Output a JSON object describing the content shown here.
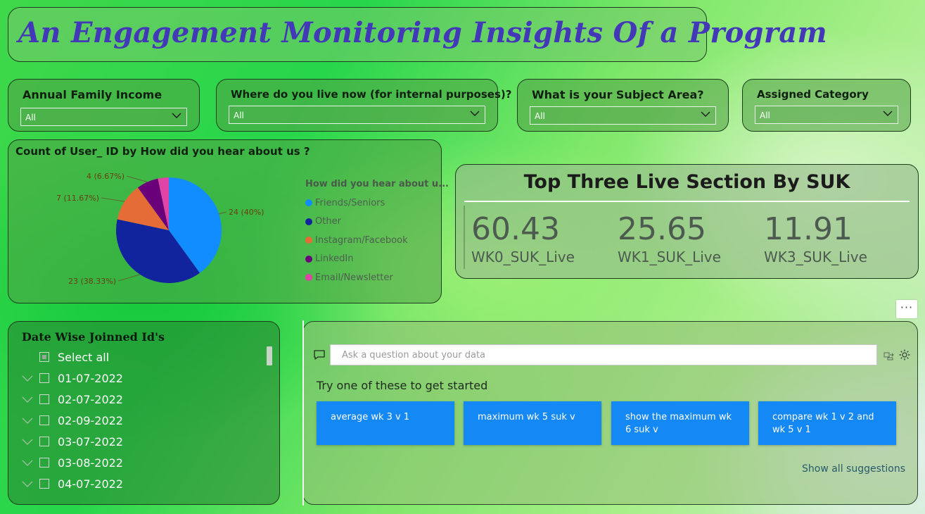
{
  "title": "An Engagement Monitoring Insights Of a Program",
  "slicers": [
    {
      "label": "Annual Family Income",
      "value": "All"
    },
    {
      "label": "Where do you live now (for internal purposes)?",
      "value": "All"
    },
    {
      "label": "What is your Subject Area?",
      "value": "All"
    },
    {
      "label": "Assigned Category",
      "value": "All"
    }
  ],
  "pie_panel": {
    "title": "Count of User_ ID by How did you hear about us ?",
    "legend_title": "How did you hear about u..."
  },
  "chart_data": {
    "type": "pie",
    "title": "Count of User_ ID by How did you hear about us ?",
    "legend_title": "How did you hear about u...",
    "legend_position": "right",
    "slices": [
      {
        "name": "Friends/Seniors",
        "value": 24,
        "percent": 40,
        "label": "24 (40%)",
        "color": "#118dff"
      },
      {
        "name": "Other",
        "value": 23,
        "percent": 38.33,
        "label": "23 (38.33%)",
        "color": "#12239e"
      },
      {
        "name": "Instagram/Facebook",
        "value": 7,
        "percent": 11.67,
        "label": "7 (11.67%)",
        "color": "#e66c37"
      },
      {
        "name": "LinkedIn",
        "value": 4,
        "percent": 6.67,
        "label": "4 (6.67%)",
        "color": "#6b007b"
      },
      {
        "name": "Email/Newsletter",
        "value": 2,
        "percent": 3.33,
        "label": "",
        "color": "#e044a7"
      }
    ]
  },
  "kpi": {
    "title": "Top Three Live Section By SUK",
    "cards": [
      {
        "value": "60.43",
        "label": "WK0_SUK_Live"
      },
      {
        "value": "25.65",
        "label": "WK1_SUK_Live"
      },
      {
        "value": "11.91",
        "label": "WK3_SUK_Live"
      }
    ]
  },
  "date_slicer": {
    "title": "Date Wise Joinned Id's",
    "select_all": "Select all",
    "dates": [
      "01-07-2022",
      "02-07-2022",
      "02-09-2022",
      "03-07-2022",
      "03-08-2022",
      "04-07-2022"
    ]
  },
  "qna": {
    "placeholder": "Ask a question about your data",
    "try_text": "Try one of these to get started",
    "suggestions": [
      "average wk 3 v 1",
      "maximum wk 5 suk v",
      "show the maximum wk 6 suk v",
      "compare wk 1 v 2 and wk 5 v 1"
    ],
    "show_all": "Show all suggestions"
  },
  "more_options": "···"
}
